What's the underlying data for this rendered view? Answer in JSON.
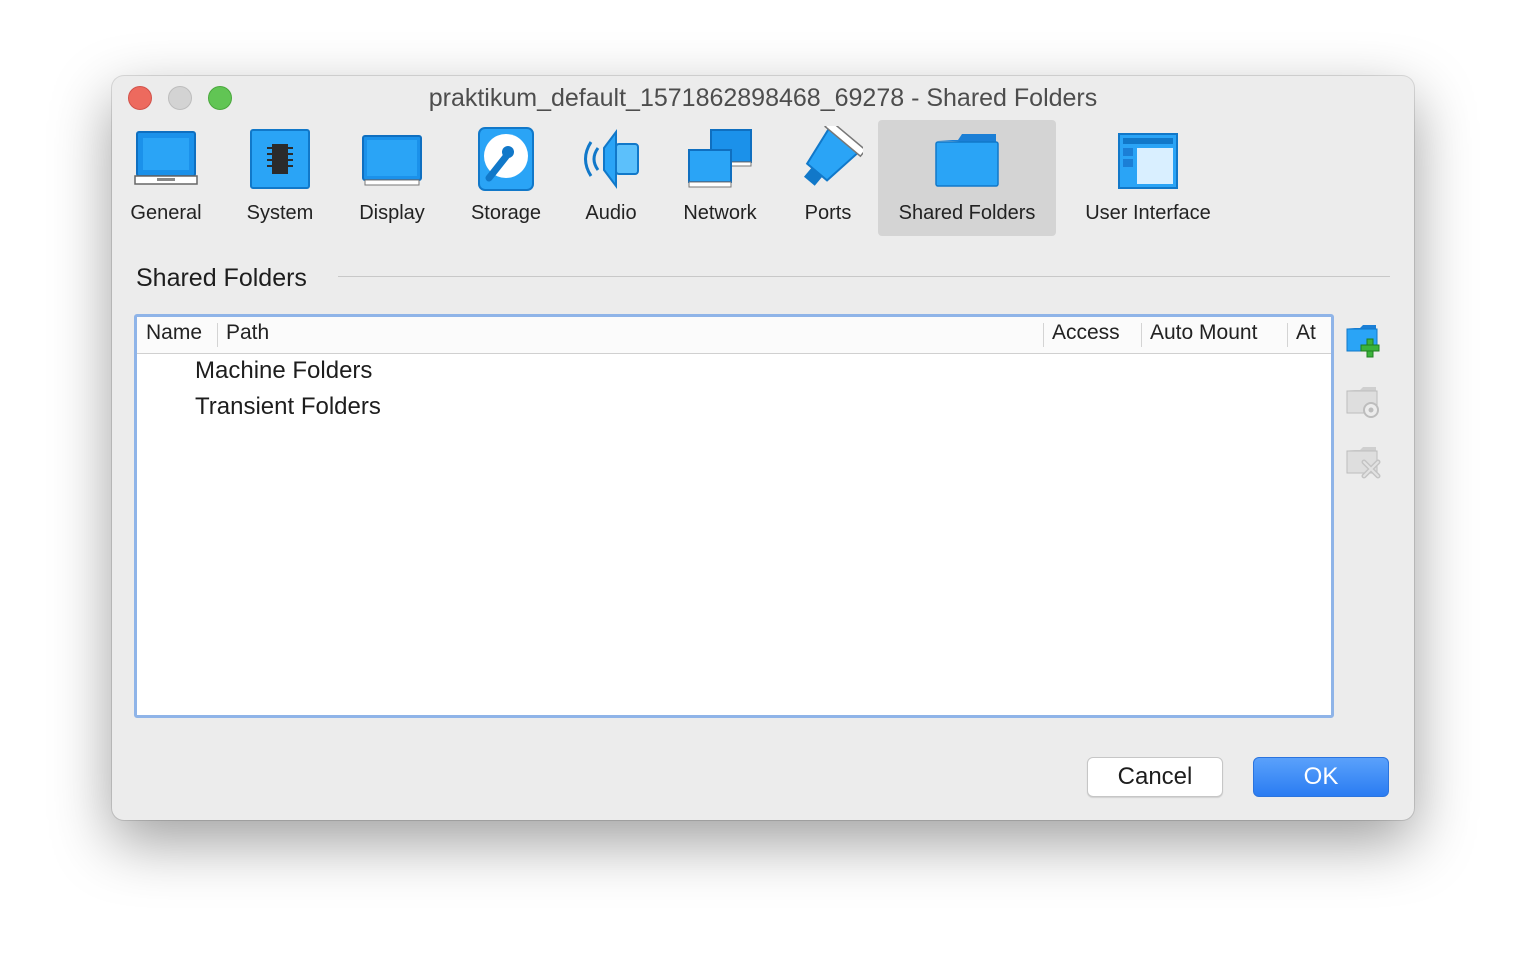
{
  "window": {
    "title": "praktikum_default_1571862898468_69278 - Shared Folders"
  },
  "toolbar": {
    "items": [
      {
        "label": "General",
        "icon": "general-icon"
      },
      {
        "label": "System",
        "icon": "system-icon"
      },
      {
        "label": "Display",
        "icon": "display-icon"
      },
      {
        "label": "Storage",
        "icon": "storage-icon"
      },
      {
        "label": "Audio",
        "icon": "audio-icon"
      },
      {
        "label": "Network",
        "icon": "network-icon"
      },
      {
        "label": "Ports",
        "icon": "ports-icon"
      },
      {
        "label": "Shared Folders",
        "icon": "shared-folders-icon",
        "selected": true
      },
      {
        "label": "User Interface",
        "icon": "user-interface-icon"
      }
    ]
  },
  "section": {
    "title": "Shared Folders"
  },
  "table": {
    "columns": [
      "Name",
      "Path",
      "Access",
      "Auto Mount",
      "At"
    ],
    "rows": [
      "Machine Folders",
      "Transient Folders"
    ]
  },
  "side_buttons": [
    "add-folder-icon",
    "edit-folder-icon",
    "remove-folder-icon"
  ],
  "buttons": {
    "cancel": "Cancel",
    "ok": "OK"
  },
  "colors": {
    "accent": "#2a7cf2",
    "icon_blue": "#1a8fe8",
    "selection": "#d4d4d4"
  }
}
